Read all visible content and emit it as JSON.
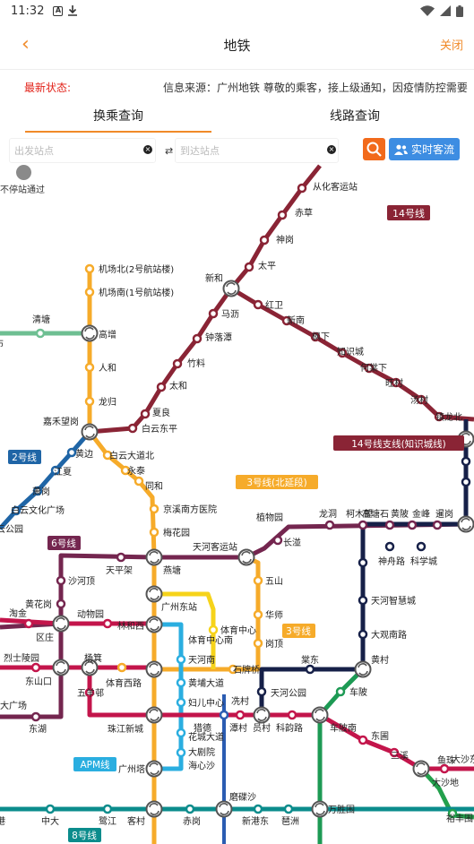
{
  "status_bar": {
    "time": "11:32",
    "icon_a": "A"
  },
  "nav": {
    "back_icon": "‹",
    "title": "地铁",
    "close": "关闭"
  },
  "notice": {
    "label": "最新状态:",
    "text": "信息来源：广州地铁 尊敬的乘客，接上级通知，因疫情防控需要"
  },
  "tabs": [
    {
      "label": "换乘查询",
      "active": true
    },
    {
      "label": "线路查询",
      "active": false
    }
  ],
  "search": {
    "from_placeholder": "出发站点",
    "to_placeholder": "到达站点",
    "swap_icon": "⇄",
    "realtime_label": "实时客流"
  },
  "legend": {
    "label": "不停站通过"
  },
  "map": {
    "line_labels": {
      "l14": "14号线",
      "l14b": "14号线支线(知识城线)",
      "l2": "2号线",
      "l3n": "3号线(北延段)",
      "l6": "6号线",
      "l3": "3号线",
      "apm": "APM线",
      "l8": "8号线"
    },
    "stations": {
      "s_conghua": "从化客运站",
      "s_chicao": "赤草",
      "s_shengang": "神岗",
      "s_taiping": "太平",
      "s_xinhe": "新和",
      "s_hongwei": "红卫",
      "s_xinnan": "新南",
      "s_fengxia": "枫下",
      "s_zhishicheng": "知识城",
      "s_hexiacun": "何棠下",
      "s_wangcun": "旺村",
      "s_tangcun": "汤村",
      "s_zhenlongbei": "镇龙北",
      "s_malin": "马沥",
      "s_zhongluotan": "钟落潭",
      "s_zhuliao": "竹料",
      "s_taihe": "太和",
      "s_xiamao": "夏良",
      "s_baiyundongping": "白云东平",
      "s_jcb2": "机场北(2号航站楼)",
      "s_jcn1": "机场南(1号航站楼)",
      "s_gaozeng": "高增",
      "s_renhe": "人和",
      "s_longgui": "龙归",
      "s_jiahewanggang": "嘉禾望岗",
      "s_qingtang": "清塘",
      "s_huangbian": "黄边",
      "s_jiangxia": "江夏",
      "s_xiaogang": "萧岗",
      "s_baiyunwenhua": "白云文化广场",
      "s_baiyundadaobei": "白云大道北",
      "s_yongtai": "永泰",
      "s_tonghe": "同和",
      "s_jingxinan": "京溪南方医院",
      "s_meihuayuan": "梅花园",
      "s_zhiwuyuan": "植物园",
      "s_longdong": "龙洞",
      "s_kemucun": "柯木塱",
      "s_gaotang": "高塘石",
      "s_huangpi": "黄陂",
      "s_jinfeng": "金峰",
      "s_xiangang": "暹岗",
      "s_changban": "长湴",
      "s_tianhekeyunzhan": "天河客运站",
      "s_tianpingjia": "天平架",
      "s_yantang": "燕塘",
      "s_shahe": "沙河顶",
      "s_huanghuagang": "黄花岗",
      "s_donghuashan": "动物园",
      "s_linhexi": "林和西",
      "s_guangzhoudongzhan": "广州东站",
      "s_tiyuzhongxin": "体育中心",
      "s_tiyuzhongxinnan": "体育中心南",
      "s_tianhenan": "天河南",
      "s_wushan": "五山",
      "s_huashi": "华师",
      "s_gangding": "岗顶",
      "s_shenzhoulu": "神舟路",
      "s_kexuecheng": "科学城",
      "s_tianhezhihuicheng": "天河智慧城",
      "s_daguannanlu": "大观南路",
      "s_huangcun": "黄村",
      "s_taogan": "淘金",
      "s_ququ": "区庄",
      "s_lieshilingyuan": "烈士陵园",
      "s_yangji": "杨箕",
      "s_tiyuxilu": "体育西路",
      "s_shipaiqiao": "石牌桥",
      "s_dongshankou": "东山口",
      "s_wuyangcun": "五羊邨",
      "s_dagangchang": "大广场",
      "s_donghu": "东湖",
      "s_zhujiangxincheng": "珠江新城",
      "s_huangpudadao": "黄埔大道",
      "s_fuershangzhong": "妇儿中心",
      "s_liecun": "猎德",
      "s_huachengdadao": "花城大道",
      "s_darjuyuan": "大剧院",
      "s_haixinsha": "海心沙",
      "s_guangzhouta": "广州塔",
      "s_xiancun": "冼村",
      "s_tanyuan": "潭村",
      "s_yuancun": "员村",
      "s_kezhulu": "科韵路",
      "s_chebeinan": "车陂南",
      "s_chebei": "车陂",
      "s_tangdong": "棠东",
      "s_tianhegongyuan": "天河公园",
      "s_dongpu": "东圃",
      "s_sanxi": "三溪",
      "s_yuzhu": "鱼珠",
      "s_dashadong": "大沙东",
      "s_dashadi": "大沙地",
      "s_yufengwei": "裕丰围",
      "s_zhongda": "中大",
      "s_lujiang": "鹭江",
      "s_kecun": "客村",
      "s_chigang": "赤岗",
      "s_modie": "磨碟沙",
      "s_xingangdong": "新港东",
      "s_pazhou": "琶洲",
      "s_wanshengwei": "万胜围",
      "s_cang": "港",
      "s_bu": "布",
      "s_yungongyuan": "云公园"
    }
  }
}
